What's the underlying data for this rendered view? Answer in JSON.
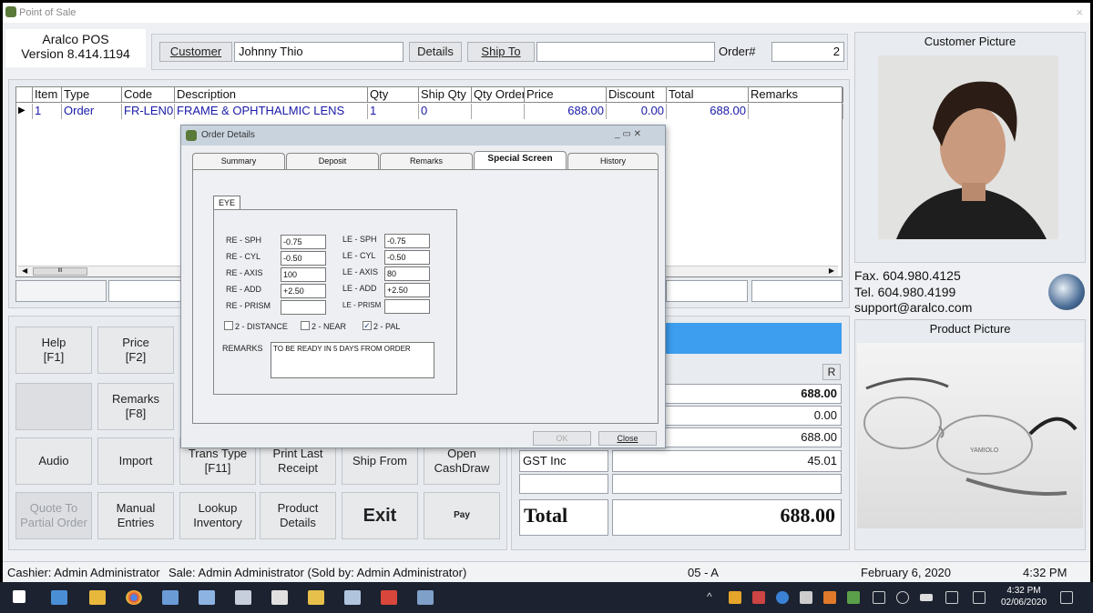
{
  "window": {
    "title": "Point of Sale",
    "close": "×"
  },
  "version": {
    "line1": "Aralco POS",
    "line2": "Version 8.414.1194"
  },
  "header": {
    "customer_btn": "Customer",
    "customer_name": "Johnny Thio",
    "details_btn": "Details",
    "shipto_btn": "Ship To",
    "shipto_value": "",
    "order_label": "Order#",
    "order_value": "2"
  },
  "grid": {
    "columns": [
      "Item",
      "Type",
      "Code",
      "Description",
      "Qty",
      "Ship Qty",
      "Qty Order",
      "Price",
      "Discount",
      "Total",
      "Remarks"
    ],
    "rows": [
      {
        "item": "1",
        "type": "Order",
        "code": "FR-LEN0",
        "description": "FRAME & OPHTHALMIC LENS",
        "qty": "1",
        "ship_qty": "0",
        "qty_order": "",
        "price": "688.00",
        "discount": "0.00",
        "total": "688.00",
        "remarks": ""
      }
    ],
    "scroll_label": "III"
  },
  "buttons": {
    "help": [
      "Help",
      "[F1]"
    ],
    "price": [
      "Price",
      "[F2]"
    ],
    "remarks": [
      "Remarks",
      "[F8]"
    ],
    "audio": "Audio",
    "import": "Import",
    "trans_type": [
      "Trans Type",
      "[F11]"
    ],
    "print_last": [
      "Print Last",
      "Receipt"
    ],
    "ship_from": "Ship From",
    "open_cash": [
      "Open",
      "CashDraw"
    ],
    "quote": [
      "Quote To",
      "Partial Order"
    ],
    "manual": [
      "Manual",
      "Entries"
    ],
    "lookup": [
      "Lookup",
      "Inventory"
    ],
    "product_details": [
      "Product",
      "Details"
    ],
    "exit": "Exit",
    "pay": "Pay"
  },
  "totals": {
    "r_btn": "R",
    "subtotal": "688.00",
    "discount": "0.00",
    "net": "688.00",
    "tax_label": "GST Inc",
    "tax_value": "45.01",
    "total_label": "Total",
    "total_value": "688.00"
  },
  "right": {
    "customer_picture": "Customer Picture",
    "fax": "Fax.  604.980.4125",
    "tel": "Tel.  604.980.4199",
    "email": "support@aralco.com",
    "product_picture": "Product Picture",
    "glasses_brand": "YAMIOLO"
  },
  "dialog": {
    "title": "Order Details",
    "tabs": [
      "Summary",
      "Deposit",
      "Remarks",
      "Special Screen",
      "History"
    ],
    "active_tab": "Special Screen",
    "eye_tab": "EYE",
    "re_labels": [
      "RE - SPH",
      "RE - CYL",
      "RE - AXIS",
      "RE - ADD",
      "RE - PRISM"
    ],
    "re_values": [
      "-0.75",
      "-0.50",
      "100",
      "+2.50",
      ""
    ],
    "le_labels": [
      "LE - SPH",
      "LE - CYL",
      "LE - AXIS",
      "LE - ADD",
      "LE - PRISM"
    ],
    "le_values": [
      "-0.75",
      "-0.50",
      "80",
      "+2.50",
      ""
    ],
    "checks": [
      {
        "label": "2 - DISTANCE",
        "checked": false
      },
      {
        "label": "2 - NEAR",
        "checked": false
      },
      {
        "label": "2 - PAL",
        "checked": true
      }
    ],
    "remarks_label": "REMARKS",
    "remarks_value": "TO BE READY IN 5 DAYS FROM ORDER",
    "ok": "OK",
    "close": "Close",
    "ctrl": "_  ▭  ✕"
  },
  "status": {
    "cashier": "Cashier: Admin Administrator",
    "sale": "Sale: Admin Administrator   (Sold by: Admin Administrator)",
    "station": "05 - A",
    "date": "February 6, 2020",
    "time": "4:32 PM"
  },
  "taskbar": {
    "time": "4:32 PM",
    "date": "02/06/2020"
  },
  "colors": {
    "accent_blue": "#3d9eef",
    "dialog_title": "#c9d3de"
  }
}
